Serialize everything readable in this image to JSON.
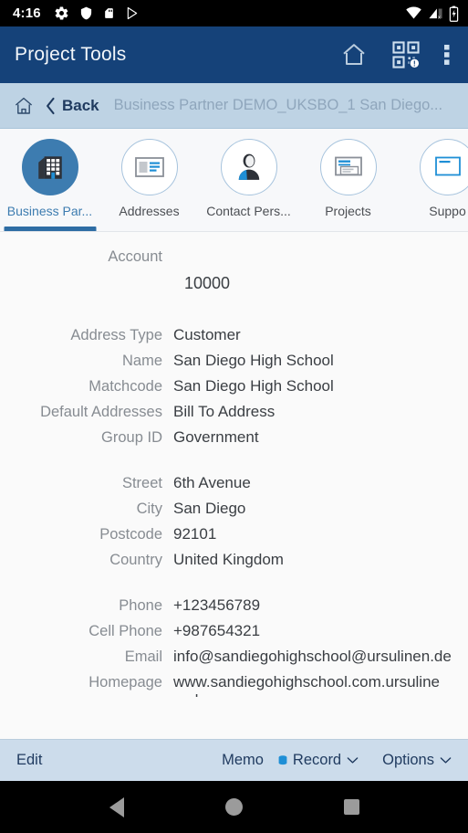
{
  "status_bar": {
    "time": "4:16",
    "left_icons": [
      "gear-icon",
      "shield-icon",
      "sd-card-icon",
      "play-store-icon"
    ],
    "right_icons": [
      "wifi-icon",
      "cellular-signal-off-icon",
      "battery-charging-icon"
    ]
  },
  "header": {
    "title": "Project Tools",
    "actions": [
      {
        "name": "home-icon"
      },
      {
        "name": "qr-scanner-icon"
      },
      {
        "name": "overflow-menu-icon"
      }
    ]
  },
  "breadcrumb": {
    "home_icon": "home-outline-icon",
    "back_label": "Back",
    "path": "Business Partner DEMO_UKSBO_1 San Diego..."
  },
  "tabs": [
    {
      "label": "Business Par...",
      "icon": "office-building-icon",
      "active": true
    },
    {
      "label": "Addresses",
      "icon": "address-card-icon",
      "active": false
    },
    {
      "label": "Contact Pers...",
      "icon": "person-icon",
      "active": false
    },
    {
      "label": "Projects",
      "icon": "window-list-icon",
      "active": false
    },
    {
      "label": "Suppo",
      "icon": "document-icon",
      "active": false
    }
  ],
  "form": {
    "account": {
      "label": "Account",
      "value": "10000"
    },
    "groups": [
      {
        "rows": [
          {
            "label": "Address Type",
            "value": "Customer"
          },
          {
            "label": "Name",
            "value": "San Diego High School"
          },
          {
            "label": "Matchcode",
            "value": "San Diego High School"
          },
          {
            "label": "Default Addresses",
            "value": "Bill To Address"
          },
          {
            "label": "Group ID",
            "value": "Government"
          }
        ]
      },
      {
        "rows": [
          {
            "label": "Street",
            "value": "6th Avenue"
          },
          {
            "label": "City",
            "value": "San Diego"
          },
          {
            "label": "Postcode",
            "value": "92101"
          },
          {
            "label": "Country",
            "value": "United Kingdom"
          }
        ]
      },
      {
        "rows": [
          {
            "label": "Phone",
            "value": "+123456789"
          },
          {
            "label": "Cell Phone",
            "value": "+987654321"
          },
          {
            "label": "Email",
            "value": "info@sandiegohighschool@ursulinen.de"
          },
          {
            "label": "Homepage",
            "value": "www.sandiegohighschool.com.ursuline nsd.x"
          }
        ]
      }
    ]
  },
  "bottom_bar": {
    "edit_label": "Edit",
    "memo_label": "Memo",
    "memo_badge_icon": "database-badge-icon",
    "record_label": "Record",
    "options_label": "Options"
  },
  "nav_bar": {
    "back": "back-triangle-icon",
    "home": "home-circle-icon",
    "recents": "recents-square-icon"
  },
  "colors": {
    "appbar": "#154279",
    "accent": "#3d7cb0",
    "breadcrumb_bg": "#bed3e4",
    "bottom_bg": "#ccdceb",
    "content_bg": "#fafafa"
  }
}
